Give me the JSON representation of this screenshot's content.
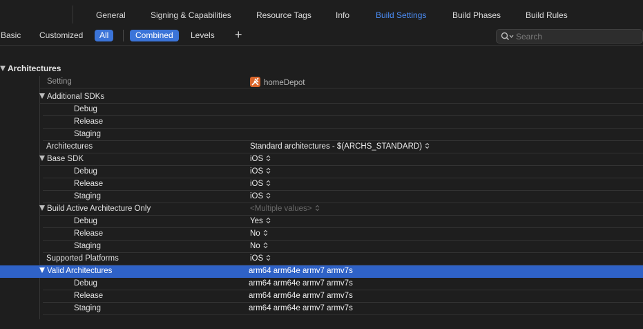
{
  "tabs": [
    {
      "label": "General"
    },
    {
      "label": "Signing & Capabilities"
    },
    {
      "label": "Resource Tags"
    },
    {
      "label": "Info"
    },
    {
      "label": "Build Settings"
    },
    {
      "label": "Build Phases"
    },
    {
      "label": "Build Rules"
    }
  ],
  "active_tab": "Build Settings",
  "filter": {
    "basic": "Basic",
    "customized": "Customized",
    "all": "All",
    "combined": "Combined",
    "levels": "Levels",
    "add": "+",
    "search_placeholder": "Search"
  },
  "section": {
    "title": "Architectures",
    "column_header": "Setting",
    "target_name": "homeDepot"
  },
  "rows": {
    "additional_sdks": "Additional SDKs",
    "additional_sdks_debug": "Debug",
    "additional_sdks_release": "Release",
    "additional_sdks_staging": "Staging",
    "architectures": "Architectures",
    "architectures_value": "Standard architectures  -  $(ARCHS_STANDARD)",
    "base_sdk": "Base SDK",
    "base_sdk_value": "iOS",
    "base_sdk_debug": "Debug",
    "base_sdk_debug_value": "iOS",
    "base_sdk_release": "Release",
    "base_sdk_release_value": "iOS",
    "base_sdk_staging": "Staging",
    "base_sdk_staging_value": "iOS",
    "baao": "Build Active Architecture Only",
    "baao_value": "<Multiple values>",
    "baao_debug": "Debug",
    "baao_debug_value": "Yes",
    "baao_release": "Release",
    "baao_release_value": "No",
    "baao_staging": "Staging",
    "baao_staging_value": "No",
    "supported_platforms": "Supported Platforms",
    "supported_platforms_value": "iOS",
    "valid_archs": "Valid Architectures",
    "valid_archs_value": "arm64 arm64e armv7 armv7s",
    "valid_archs_debug": "Debug",
    "valid_archs_debug_value": "arm64 arm64e armv7 armv7s",
    "valid_archs_release": "Release",
    "valid_archs_release_value": "arm64 arm64e armv7 armv7s",
    "valid_archs_staging": "Staging",
    "valid_archs_staging_value": "arm64 arm64e armv7 armv7s"
  },
  "icons": {
    "search": "magnifier-icon",
    "disclosure": "disclosure-triangle-icon",
    "popup": "popup-chevron-icon",
    "target": "hammer-app-icon"
  },
  "colors": {
    "accent": "#4c8ef7",
    "selection": "#2f62c7",
    "pill": "#3b74d8",
    "target_icon": "#d9652a"
  }
}
